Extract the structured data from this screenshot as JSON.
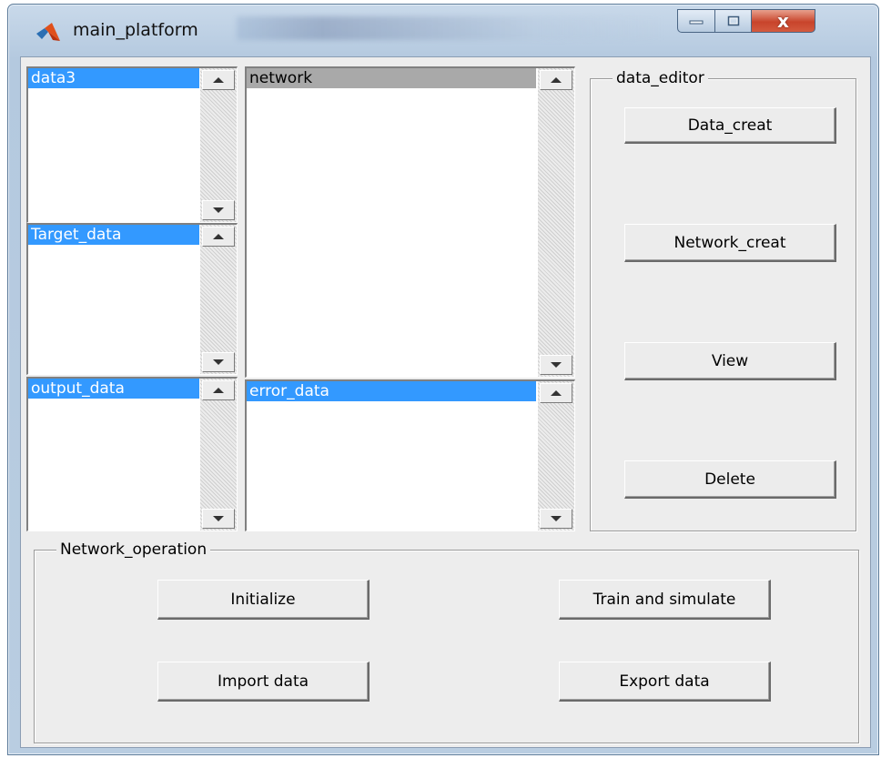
{
  "window": {
    "title": "main_platform",
    "controls": {
      "minimize": "minimize-icon",
      "maximize": "maximize-icon",
      "close": "x"
    }
  },
  "lists": {
    "data3": {
      "items": [
        "data3"
      ]
    },
    "target_data": {
      "items": [
        "Target_data"
      ]
    },
    "output_data": {
      "items": [
        "output_data"
      ]
    },
    "network": {
      "items": [
        "network"
      ]
    },
    "error_data": {
      "items": [
        "error_data"
      ]
    }
  },
  "data_editor": {
    "title": "data_editor",
    "buttons": {
      "data_creat": "Data_creat",
      "network_creat": "Network_creat",
      "view": "View",
      "delete": "Delete"
    }
  },
  "network_operation": {
    "title": "Network_operation",
    "buttons": {
      "initialize": "Initialize",
      "train_simulate": "Train and simulate",
      "import_data": "Import data",
      "export_data": "Export data"
    }
  },
  "colors": {
    "selection": "#3399ff",
    "selection_inactive": "#a9a9a9",
    "panel": "#ededed",
    "close_button": "#c8442b"
  }
}
